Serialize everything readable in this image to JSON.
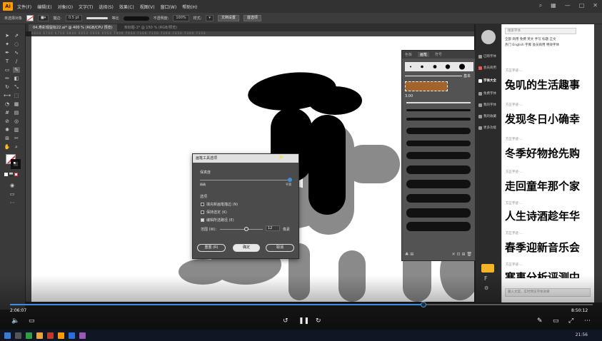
{
  "menubar": {
    "items": [
      "文件(F)",
      "编辑(E)",
      "对象(O)",
      "文字(T)",
      "选择(S)",
      "效果(C)",
      "视图(V)",
      "窗口(W)",
      "帮助(H)"
    ]
  },
  "control_bar": {
    "object_label": "未选择对象",
    "stroke_label": "描边:",
    "stroke_value": "0.5 pt",
    "profile_label": "等比",
    "opacity_label": "不透明度:",
    "opacity_value": "100%",
    "style_label": "样式:",
    "doc_setup_button": "文档设置",
    "prefs_button": "首选项"
  },
  "tabs": {
    "active": "04.寿彩观鼠标22.ai* @ 400 % (RGB/CPU 预览)",
    "inactive": "未标题-1* @ 150 % (RGB/预览)"
  },
  "ruler_text": "6600  6700  6750  6800  6850  6900  6950  7000  7050  7100  7150  7200  7250  7300  7350",
  "brush_panel": {
    "tabs": [
      "色板",
      "画笔",
      "符号"
    ],
    "basic_label": "基本",
    "size_value": "3.00"
  },
  "dialog": {
    "title": "画笔工具选项",
    "fidelity_label": "保真度",
    "fidelity_left": "精确",
    "fidelity_right": "平滑",
    "options_label": "选项",
    "opt_fill": "填充新画笔描边 (N)",
    "opt_keep": "保持选定 (K)",
    "opt_edit": "编辑所选路径 (E)",
    "range_label": "范围 (W):",
    "range_value": "12",
    "range_unit": "像素",
    "reset_button": "重置 (R)",
    "ok_button": "确定",
    "cancel_button": "取消"
  },
  "right_strip": {
    "items": [
      "已购字体",
      "会员商用",
      "字体大全",
      "免费字体",
      "我的字体",
      "我的收藏",
      "更多功能"
    ]
  },
  "font_panel": {
    "search_placeholder": "搜索字体",
    "categories_row1": "全部   商用   免费   英文   手写   标题   正文",
    "categories_row2": "热门   English   字库   会员商用   特效字体",
    "fonts": [
      {
        "label": "方正字迹-…",
        "sample": "兔叽的生活趣事"
      },
      {
        "label": "方正字迹-…",
        "sample": "发现冬日小确幸"
      },
      {
        "label": "方正字迹-…",
        "sample": "冬季好物抢先购"
      },
      {
        "label": "方正字迹-…",
        "sample": "走回童年那个家"
      },
      {
        "label": "方正字迹-…",
        "sample": "人生诗酒趁年华"
      },
      {
        "label": "方正字迹-…",
        "sample": "春季迎新音乐会"
      },
      {
        "label": "方正字迹-…",
        "sample": "寒事分析评测中"
      }
    ],
    "input_placeholder": "输入文案，实时预览字体效果"
  },
  "video": {
    "current_time": "2:06:07",
    "total_time": "8:50:12",
    "progress": 0.71
  },
  "taskbar": {
    "clock": "21:56"
  },
  "colors": {
    "accent": "#3a8ee6",
    "ai_logo": "#ff9a00"
  }
}
